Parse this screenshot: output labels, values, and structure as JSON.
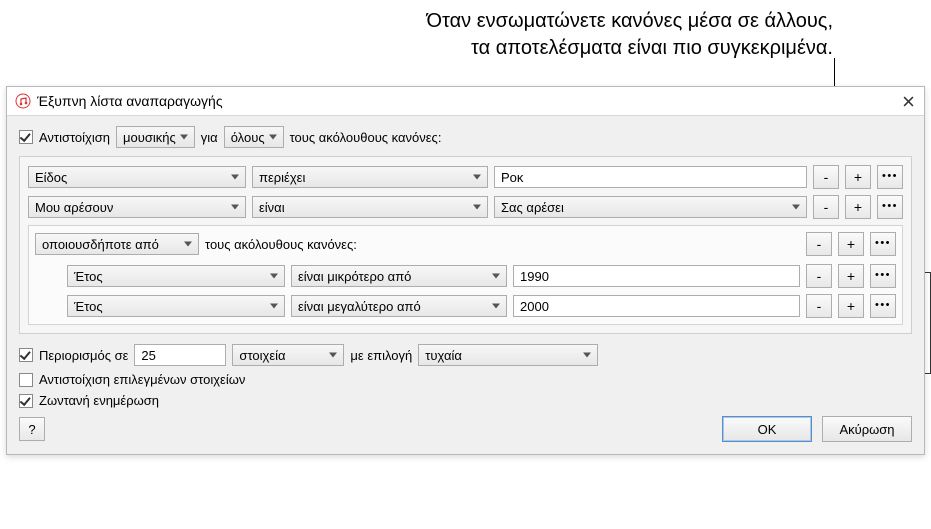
{
  "annotation": {
    "line1": "Όταν ενσωματώνετε κανόνες μέσα σε άλλους,",
    "line2": "τα αποτελέσματα είναι πιο συγκεκριμένα."
  },
  "dialog": {
    "title": "Έξυπνη λίστα αναπαραγωγής"
  },
  "match": {
    "checkbox_label": "Αντιστοίχιση",
    "library": "μουσικής",
    "for": "για",
    "scope": "όλους",
    "following": "τους ακόλουθους κανόνες:"
  },
  "rules": [
    {
      "field": "Είδος",
      "op": "περιέχει",
      "value": "Ροκ",
      "value_type": "text"
    },
    {
      "field": "Μου αρέσουν",
      "op": "είναι",
      "value": "Σας αρέσει",
      "value_type": "select"
    }
  ],
  "nested": {
    "match": "οποιουσδήποτε από",
    "following": "τους ακόλουθους κανόνες:",
    "rules": [
      {
        "field": "Έτος",
        "op": "είναι μικρότερο από",
        "value": "1990"
      },
      {
        "field": "Έτος",
        "op": "είναι μεγαλύτερο από",
        "value": "2000"
      }
    ]
  },
  "limit": {
    "checkbox_label": "Περιορισμός σε",
    "value": "25",
    "unit": "στοιχεία",
    "by_label": "με επιλογή",
    "by_value": "τυχαία"
  },
  "options": {
    "match_checked": "Αντιστοίχιση επιλεγμένων στοιχείων",
    "live_update": "Ζωντανή ενημέρωση"
  },
  "footer": {
    "help": "?",
    "ok": "OK",
    "cancel": "Ακύρωση"
  },
  "colors": {
    "button_border": "#adadad",
    "panel_border": "#cfcfcf",
    "primary_border": "#5a8ec7"
  }
}
